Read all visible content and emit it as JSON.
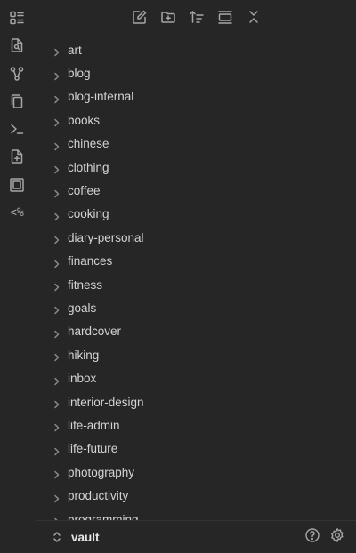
{
  "ribbon": {
    "icons": [
      "outline-icon",
      "file-search-icon",
      "graph-view-icon",
      "copy-files-icon",
      "terminal-icon",
      "new-file-icon",
      "slides-icon",
      "templater-icon"
    ],
    "templater_label": "<%"
  },
  "toolbar": {
    "icons": [
      "new-note-icon",
      "new-folder-icon",
      "sort-icon",
      "collapse-view-icon",
      "collapse-all-icon"
    ]
  },
  "folders": [
    "art",
    "blog",
    "blog-internal",
    "books",
    "chinese",
    "clothing",
    "coffee",
    "cooking",
    "diary-personal",
    "finances",
    "fitness",
    "goals",
    "hardcover",
    "hiking",
    "inbox",
    "interior-design",
    "life-admin",
    "life-future",
    "photography",
    "productivity",
    "programming"
  ],
  "footer": {
    "vault_name": "vault",
    "icons": [
      "vault-switcher-icon",
      "help-icon",
      "settings-icon"
    ]
  },
  "colors": {
    "background": "#262626",
    "text": "#d4d4d4",
    "icon": "#a6a6a6"
  }
}
